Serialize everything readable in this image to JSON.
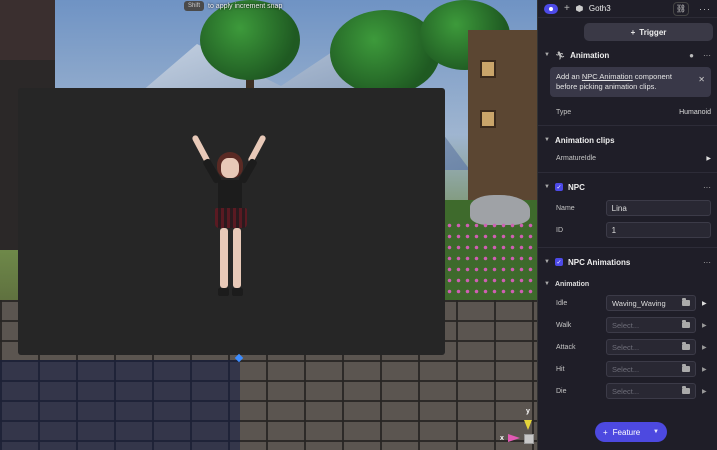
{
  "viewport": {
    "snap_hint_key": "Shift",
    "snap_hint_text": "to apply increment snap",
    "gizmo": {
      "y_label": "y",
      "x_label": "x"
    }
  },
  "inspector": {
    "header": {
      "title": "Goth3"
    },
    "trigger_button": "Trigger",
    "animation": {
      "title": "Animation",
      "notice_prefix": "Add an ",
      "notice_link": "NPC Animation",
      "notice_suffix": " component before picking animation clips.",
      "type_label": "Type",
      "type_value": "Humanoid"
    },
    "animation_clips": {
      "title": "Animation clips",
      "items": [
        "ArmatureIdle"
      ]
    },
    "npc": {
      "title": "NPC",
      "name_label": "Name",
      "name_value": "Lina",
      "id_label": "ID",
      "id_value": "1"
    },
    "npc_animations": {
      "title": "NPC Animations",
      "subsection": "Animation",
      "rows": [
        {
          "label": "Idle",
          "value": "Waving_Waving",
          "placeholder": ""
        },
        {
          "label": "Walk",
          "value": "",
          "placeholder": "Select..."
        },
        {
          "label": "Attack",
          "value": "",
          "placeholder": "Select..."
        },
        {
          "label": "Hit",
          "value": "",
          "placeholder": "Select..."
        },
        {
          "label": "Die",
          "value": "",
          "placeholder": "Select..."
        }
      ]
    },
    "feature_button": "Feature"
  },
  "colors": {
    "accent": "#4d4ae8",
    "panel_bg": "#1f1e28",
    "preview_bg": "#262626"
  }
}
